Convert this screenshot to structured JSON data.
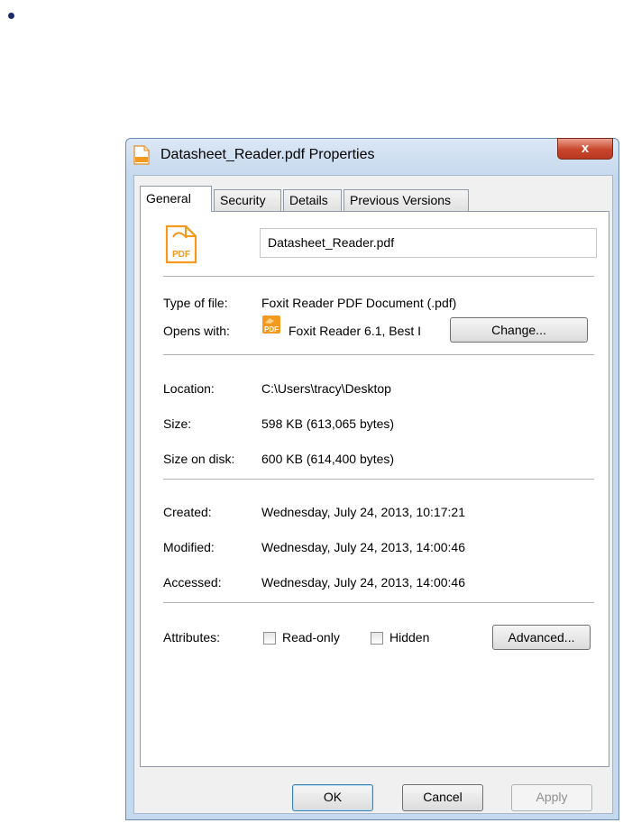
{
  "window": {
    "title": "Datasheet_Reader.pdf Properties",
    "close_label": "x"
  },
  "tabs": [
    {
      "label": "General",
      "active": true
    },
    {
      "label": "Security",
      "active": false
    },
    {
      "label": "Details",
      "active": false
    },
    {
      "label": "Previous Versions",
      "active": false
    }
  ],
  "general": {
    "file_icon_text": "PDF",
    "file_name": "Datasheet_Reader.pdf",
    "type_label": "Type of file:",
    "type_value": "Foxit Reader PDF Document (.pdf)",
    "opens_label": "Opens with:",
    "opens_value": "Foxit Reader 6.1, Best I",
    "change_button": "Change...",
    "location_label": "Location:",
    "location_value": "C:\\Users\\tracy\\Desktop",
    "size_label": "Size:",
    "size_value": "598 KB (613,065 bytes)",
    "size_on_disk_label": "Size on disk:",
    "size_on_disk_value": "600 KB (614,400 bytes)",
    "created_label": "Created:",
    "created_value": "Wednesday, July 24, 2013, 10:17:21",
    "modified_label": "Modified:",
    "modified_value": "Wednesday, July 24, 2013, 14:00:46",
    "accessed_label": "Accessed:",
    "accessed_value": "Wednesday, July 24, 2013, 14:00:46",
    "attributes_label": "Attributes:",
    "readonly_label": "Read-only",
    "readonly_checked": false,
    "hidden_label": "Hidden",
    "hidden_checked": false,
    "advanced_button": "Advanced..."
  },
  "footer": {
    "ok": "OK",
    "cancel": "Cancel",
    "apply": "Apply"
  },
  "colors": {
    "pdf_accent": "#f39a1e",
    "close_button": "#c8452c"
  }
}
